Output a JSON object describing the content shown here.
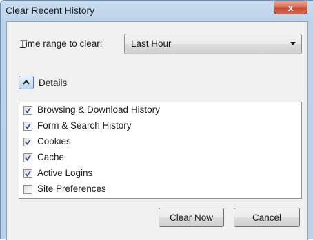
{
  "window": {
    "title": "Clear Recent History",
    "close_glyph": "x"
  },
  "time_range": {
    "label_accesskey": "T",
    "label_rest": "ime range to clear:",
    "selected": "Last Hour"
  },
  "details": {
    "toggle_icon": "chevron-up-icon",
    "label_pre": "D",
    "label_accesskey": "e",
    "label_post": "tails",
    "expanded": true
  },
  "items": [
    {
      "label": "Browsing & Download History",
      "checked": true
    },
    {
      "label": "Form & Search History",
      "checked": true
    },
    {
      "label": "Cookies",
      "checked": true
    },
    {
      "label": "Cache",
      "checked": true
    },
    {
      "label": "Active Logins",
      "checked": true
    },
    {
      "label": "Site Preferences",
      "checked": false
    }
  ],
  "buttons": {
    "clear_now": "Clear Now",
    "cancel": "Cancel"
  },
  "colors": {
    "checkmark": "#3a4f8a",
    "close_button": "#c74a32"
  }
}
